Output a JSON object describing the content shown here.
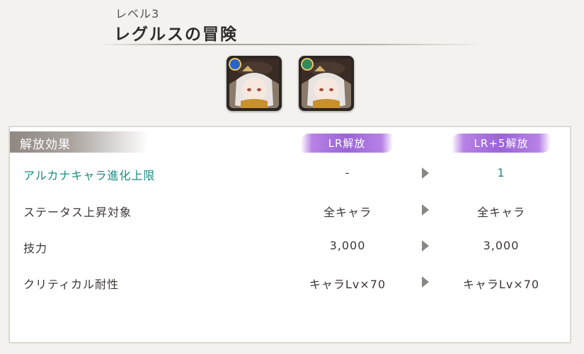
{
  "header": {
    "level": "レベル3",
    "title": "レグルスの冒険"
  },
  "characters": [
    {
      "name": "character-icon-blue-element",
      "badge_icon": "blue-element-icon",
      "badge_color": "#2a63c8"
    },
    {
      "name": "character-icon-green-element",
      "badge_icon": "green-element-icon",
      "badge_color": "#2f8a5e"
    }
  ],
  "panel": {
    "section_label": "解放効果",
    "tiers": [
      "LR解放",
      "LR+5解放"
    ],
    "rows": [
      {
        "label": "アルカナキャラ進化上限",
        "before": "-",
        "after": "1",
        "highlight": true
      },
      {
        "label": "ステータス上昇対象",
        "before": "全キャラ",
        "after": "全キャラ",
        "highlight": false
      },
      {
        "label": "技力",
        "before": "3,000",
        "after": "3,000",
        "highlight": false
      },
      {
        "label": "クリティカル耐性",
        "before": "キャラLv×70",
        "after": "キャラLv×70",
        "highlight": false
      }
    ]
  },
  "colors": {
    "highlight": "#1f8b82",
    "tier_badge": "#9a63d8",
    "section_label": "#8e8782"
  }
}
